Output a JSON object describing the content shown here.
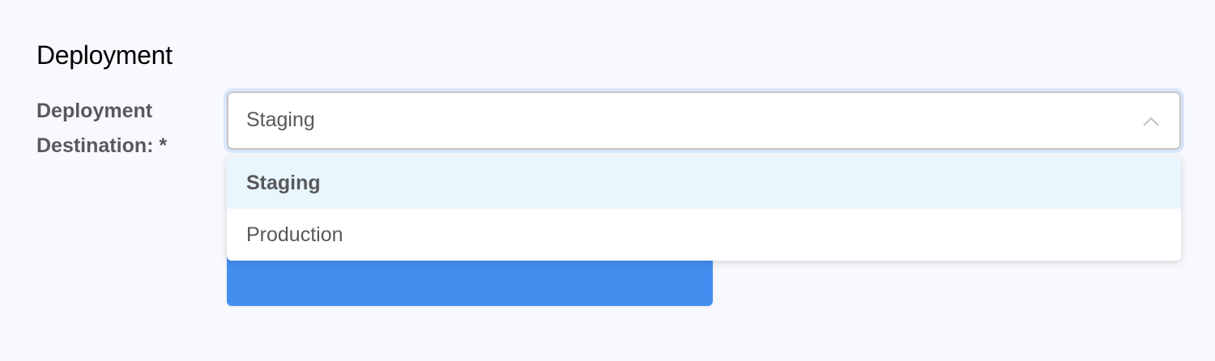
{
  "section_title": "Deployment",
  "field": {
    "label": "Deployment Destination: *",
    "selected_value": "Staging",
    "options": [
      {
        "label": "Staging",
        "selected": true
      },
      {
        "label": "Production",
        "selected": false
      }
    ]
  },
  "colors": {
    "accent": "#428ff0",
    "highlight": "#e9f6fe"
  }
}
